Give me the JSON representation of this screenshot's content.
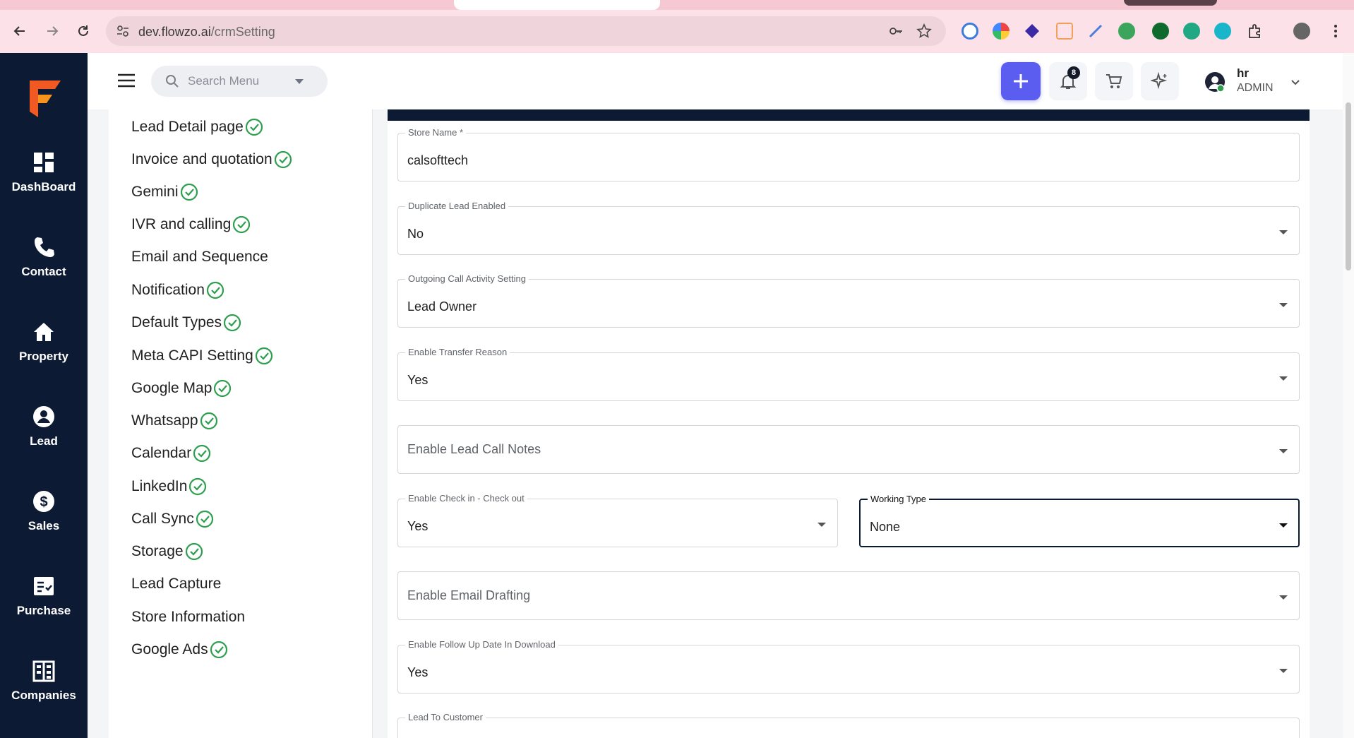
{
  "browser": {
    "url_host": "dev.flowzo.ai",
    "url_path": "/crmSetting"
  },
  "rail": {
    "items": [
      {
        "label": "DashBoard",
        "icon": "dashboard-icon"
      },
      {
        "label": "Contact",
        "icon": "phone-icon"
      },
      {
        "label": "Property",
        "icon": "home-icon"
      },
      {
        "label": "Lead",
        "icon": "person-icon"
      },
      {
        "label": "Sales",
        "icon": "dollar-icon"
      },
      {
        "label": "Purchase",
        "icon": "receipt-icon"
      },
      {
        "label": "Companies",
        "icon": "building-icon"
      }
    ]
  },
  "header": {
    "search_placeholder": "Search Menu",
    "notification_count": "8",
    "user_name": "hr",
    "user_role": "ADMIN"
  },
  "settings_menu": {
    "items": [
      {
        "label": "Lead Detail page",
        "checked": true
      },
      {
        "label": "Invoice and quotation",
        "checked": true
      },
      {
        "label": "Gemini",
        "checked": true
      },
      {
        "label": "IVR and calling",
        "checked": true
      },
      {
        "label": "Email and Sequence",
        "checked": false
      },
      {
        "label": "Notification",
        "checked": true
      },
      {
        "label": "Default Types",
        "checked": true
      },
      {
        "label": "Meta CAPI Setting",
        "checked": true
      },
      {
        "label": "Google Map",
        "checked": true
      },
      {
        "label": "Whatsapp",
        "checked": true
      },
      {
        "label": "Calendar",
        "checked": true
      },
      {
        "label": "LinkedIn",
        "checked": true
      },
      {
        "label": "Call Sync",
        "checked": true
      },
      {
        "label": "Storage",
        "checked": true
      },
      {
        "label": "Lead Capture",
        "checked": false
      },
      {
        "label": "Store Information",
        "checked": false
      },
      {
        "label": "Google Ads",
        "checked": true
      }
    ]
  },
  "form": {
    "store_name": {
      "label": "Store Name *",
      "value": "calsofttech"
    },
    "duplicate_lead": {
      "label": "Duplicate Lead Enabled",
      "value": "No"
    },
    "outgoing_call": {
      "label": "Outgoing Call Activity Setting",
      "value": "Lead Owner"
    },
    "transfer_reason": {
      "label": "Enable Transfer Reason",
      "value": "Yes"
    },
    "lead_call_notes": {
      "placeholder": "Enable Lead Call Notes"
    },
    "check_in_out": {
      "label": "Enable Check in - Check out",
      "value": "Yes"
    },
    "working_type": {
      "label": "Working Type",
      "value": "None"
    },
    "email_drafting": {
      "placeholder": "Enable Email Drafting"
    },
    "follow_up_date": {
      "label": "Enable Follow Up Date In Download",
      "value": "Yes"
    },
    "lead_to_customer": {
      "label": "Lead To Customer"
    }
  },
  "colors": {
    "rail_bg": "#0c1a33",
    "accent": "#5b5cf0",
    "check_green": "#2e9e4f",
    "browser_pink": "#fce1e8"
  }
}
